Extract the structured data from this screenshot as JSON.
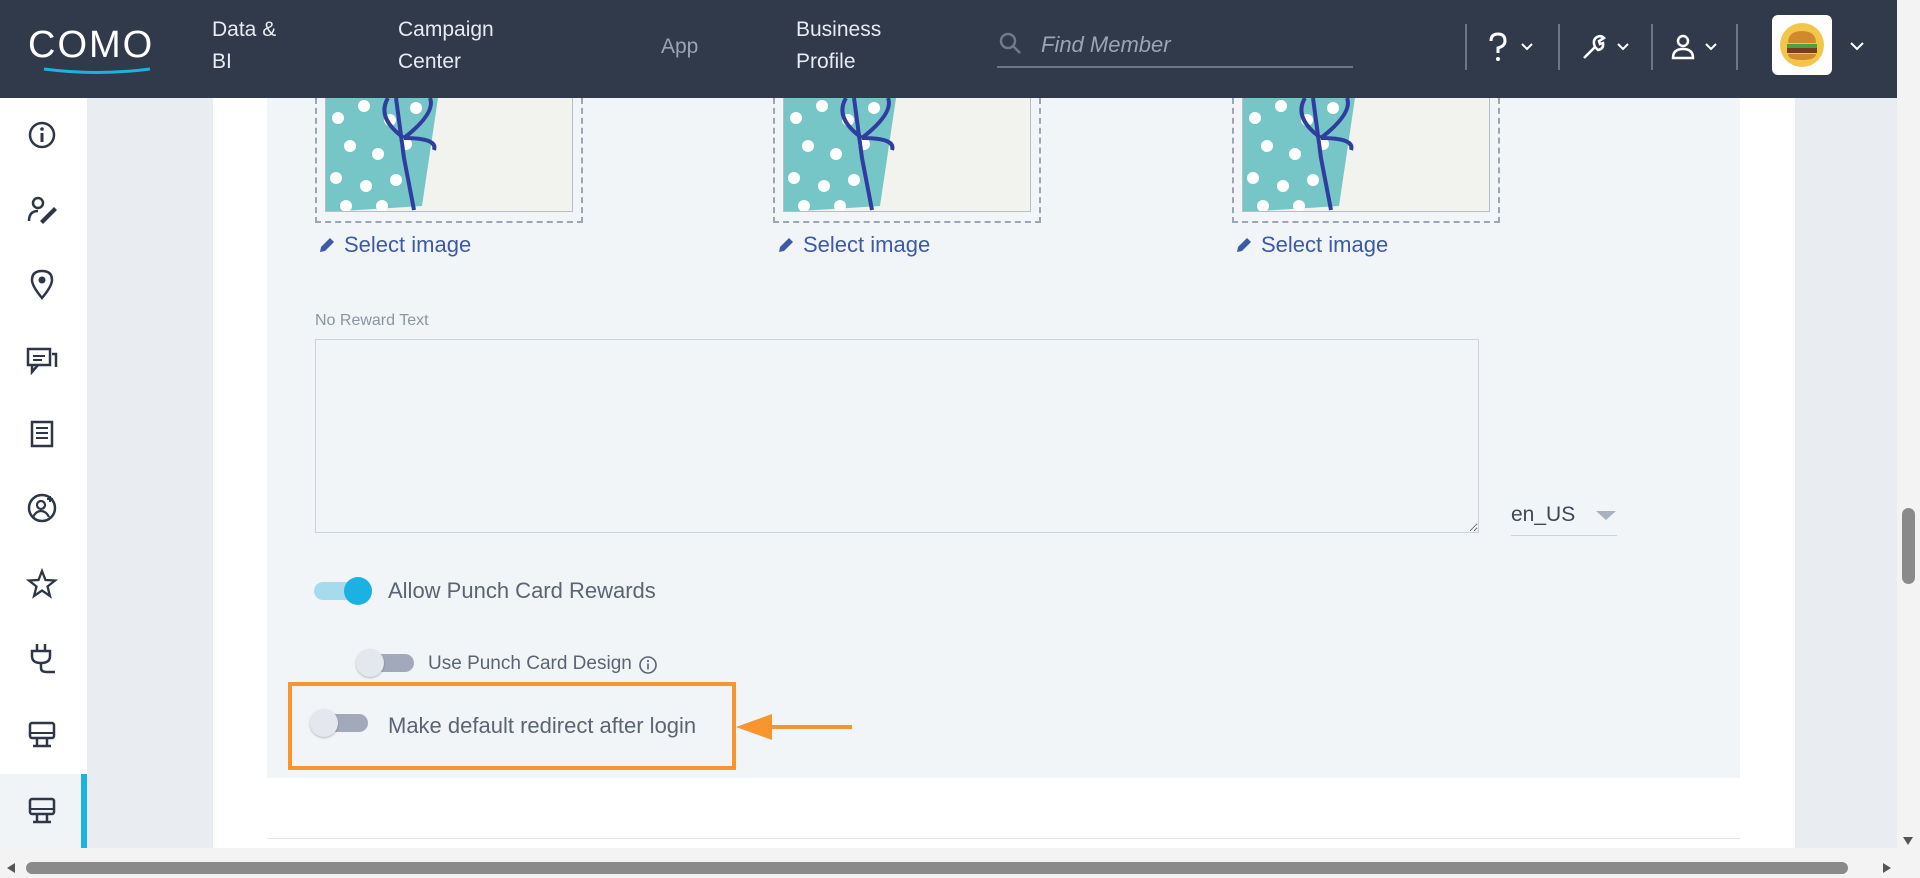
{
  "header": {
    "logo_text": "COMO",
    "nav": [
      {
        "line1": "Data &",
        "line2": "BI"
      },
      {
        "line1": "Campaign",
        "line2": "Center"
      },
      {
        "line1": "App",
        "line2": ""
      },
      {
        "line1": "Business",
        "line2": "Profile"
      }
    ],
    "search_placeholder": "Find Member",
    "menus": [
      "help-menu",
      "tools-menu",
      "user-menu"
    ]
  },
  "sidebar": {
    "items": [
      {
        "name": "info-icon"
      },
      {
        "name": "customer-edit-icon"
      },
      {
        "name": "location-pin-icon"
      },
      {
        "name": "chat-messages-icon"
      },
      {
        "name": "receipt-icon"
      },
      {
        "name": "member-add-icon"
      },
      {
        "name": "star-icon"
      },
      {
        "name": "plug-icon"
      },
      {
        "name": "kiosk-icon"
      },
      {
        "name": "kiosk-icon-active"
      }
    ]
  },
  "content": {
    "select_image_label": "Select image",
    "no_reward_label": "No Reward Text",
    "no_reward_value": "",
    "language": "en_US",
    "toggles": {
      "allow_punch": {
        "label": "Allow Punch Card Rewards",
        "on": true
      },
      "use_design": {
        "label": "Use Punch Card Design",
        "on": false
      },
      "default_redirect": {
        "label": "Make default redirect after login",
        "on": false
      }
    }
  },
  "colors": {
    "header_bg": "#303a4a",
    "accent": "#1bb1e3",
    "link": "#3c5aa6",
    "highlight": "#f7952f"
  }
}
